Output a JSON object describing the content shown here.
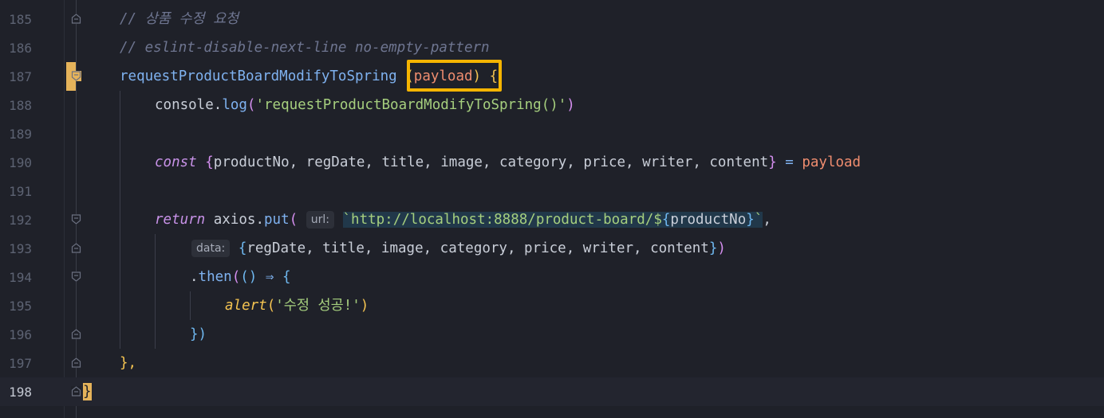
{
  "editor": {
    "lines": [
      {
        "num": "185",
        "comment": "// 상품 수정 요청"
      },
      {
        "num": "186",
        "comment": "// eslint-disable-next-line no-empty-pattern"
      },
      {
        "num": "187",
        "fn_name": "requestProductBoardModifyToSpring",
        "param": "payload",
        "open": "{"
      },
      {
        "num": "188",
        "obj": "console",
        "method": "log",
        "string": "'requestProductBoardModifyToSpring()'"
      },
      {
        "num": "189"
      },
      {
        "num": "190",
        "keyword": "const",
        "fields": "productNo, regDate, title, image, category, price, writer, content",
        "assign": "=",
        "value": "payload"
      },
      {
        "num": "191"
      },
      {
        "num": "192",
        "keyword": "return",
        "obj": "axios",
        "method": "put",
        "hint": "url:",
        "url_prefix": "`http://localhost:8888/product-board/$",
        "url_var": "productNo",
        "url_suffix": "`"
      },
      {
        "num": "193",
        "hint": "data:",
        "fields": "regDate, title, image, category, price, writer, content"
      },
      {
        "num": "194",
        "method": "then",
        "arrow": "⇒"
      },
      {
        "num": "195",
        "fn_name": "alert",
        "string": "'수정 성공!'"
      },
      {
        "num": "196",
        "close": "})"
      },
      {
        "num": "197",
        "close": "},"
      },
      {
        "num": "198",
        "close": "}"
      }
    ]
  },
  "colors": {
    "background": "#1f2129",
    "highlight_box": "#f5b400",
    "bookmark": "#e5b35a"
  }
}
